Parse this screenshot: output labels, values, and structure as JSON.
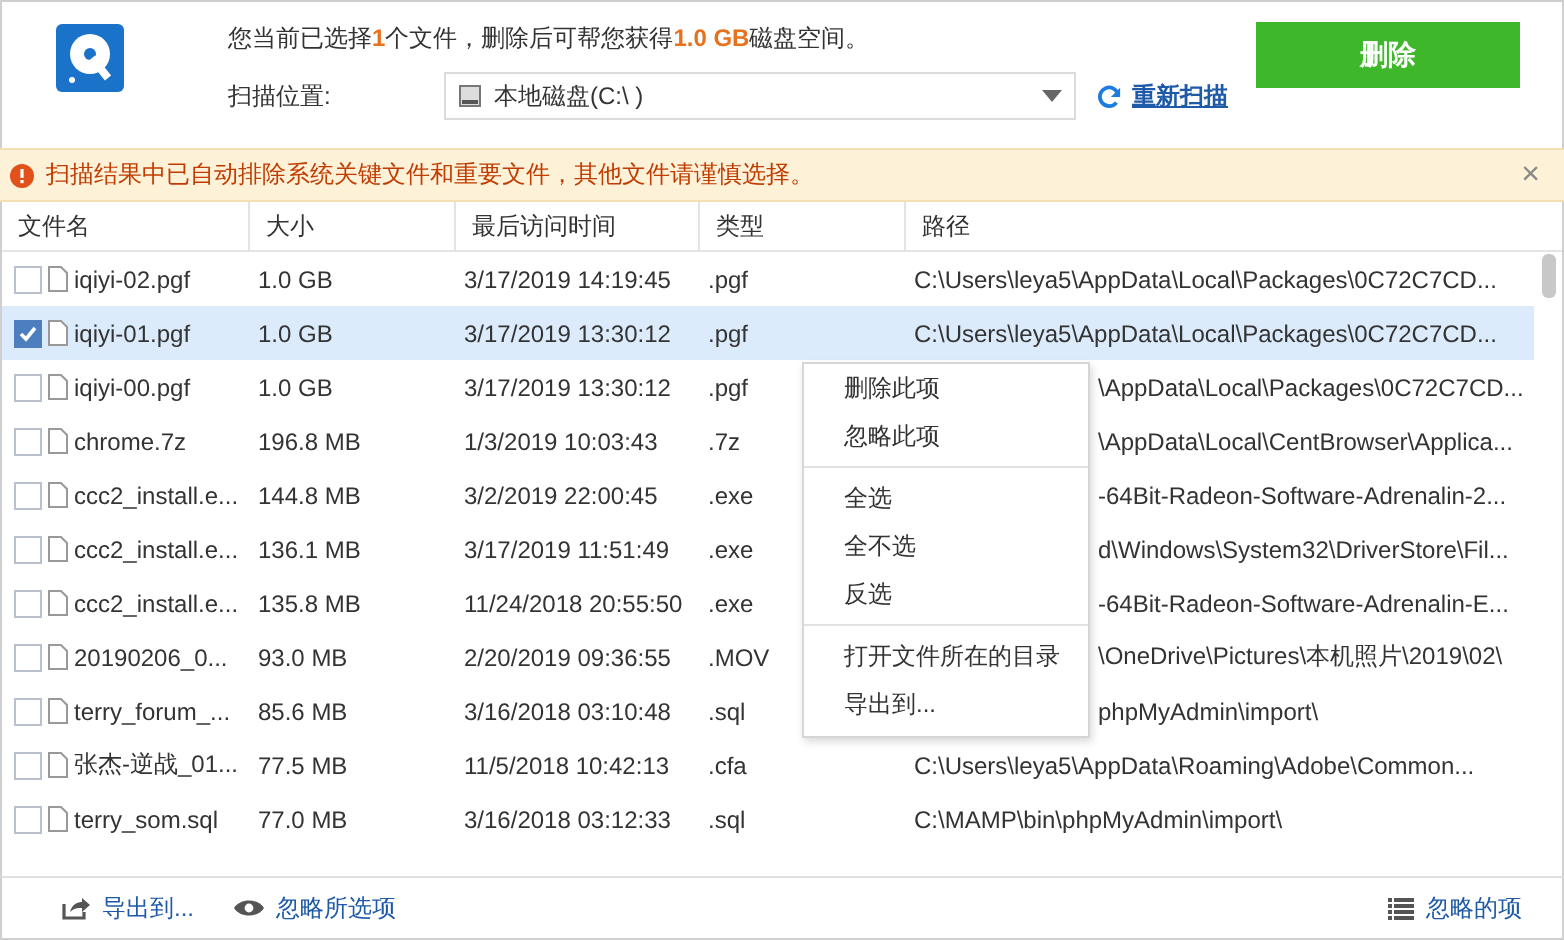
{
  "header": {
    "summary": "您当前已选择**1**个文件，删除后可帮您获得**1.0 GB**磁盘空间。",
    "scan_label": "扫描位置:",
    "location": "本地磁盘(C:\\ )",
    "rescan": "重新扫描",
    "delete_button": "删除"
  },
  "notice": {
    "text": "扫描结果中已自动排除系统关键文件和重要文件，其他文件请谨慎选择。",
    "close": "×"
  },
  "columns": [
    "文件名",
    "大小",
    "最后访问时间",
    "类型",
    "路径"
  ],
  "rows": [
    {
      "checked": false,
      "selected": false,
      "name": "iqiyi-02.pgf",
      "size": "1.0 GB",
      "time": "3/17/2019 14:19:45",
      "type": ".pgf",
      "path": "C:\\Users\\leya5\\AppData\\Local\\Packages\\0C72C7CD..."
    },
    {
      "checked": true,
      "selected": true,
      "name": "iqiyi-01.pgf",
      "size": "1.0 GB",
      "time": "3/17/2019 13:30:12",
      "type": ".pgf",
      "path": "C:\\Users\\leya5\\AppData\\Local\\Packages\\0C72C7CD..."
    },
    {
      "checked": false,
      "selected": false,
      "name": "iqiyi-00.pgf",
      "size": "1.0 GB",
      "time": "3/17/2019 13:30:12",
      "type": ".pgf",
      "path": "\\AppData\\Local\\Packages\\0C72C7CD..."
    },
    {
      "checked": false,
      "selected": false,
      "name": "chrome.7z",
      "size": "196.8 MB",
      "time": "1/3/2019 10:03:43",
      "type": ".7z",
      "path": "\\AppData\\Local\\CentBrowser\\Applica..."
    },
    {
      "checked": false,
      "selected": false,
      "name": "ccc2_install.e...",
      "size": "144.8 MB",
      "time": "3/2/2019 22:00:45",
      "type": ".exe",
      "path": "-64Bit-Radeon-Software-Adrenalin-2..."
    },
    {
      "checked": false,
      "selected": false,
      "name": "ccc2_install.e...",
      "size": "136.1 MB",
      "time": "3/17/2019 11:51:49",
      "type": ".exe",
      "path": "d\\Windows\\System32\\DriverStore\\Fil..."
    },
    {
      "checked": false,
      "selected": false,
      "name": "ccc2_install.e...",
      "size": "135.8 MB",
      "time": "11/24/2018 20:55:50",
      "type": ".exe",
      "path": "-64Bit-Radeon-Software-Adrenalin-E..."
    },
    {
      "checked": false,
      "selected": false,
      "name": "20190206_0...",
      "size": "93.0 MB",
      "time": "2/20/2019 09:36:55",
      "type": ".MOV",
      "path": "\\OneDrive\\Pictures\\本机照片\\2019\\02\\"
    },
    {
      "checked": false,
      "selected": false,
      "name": "terry_forum_...",
      "size": "85.6 MB",
      "time": "3/16/2018 03:10:48",
      "type": ".sql",
      "path": "phpMyAdmin\\import\\"
    },
    {
      "checked": false,
      "selected": false,
      "name": "张杰-逆战_01...",
      "size": "77.5 MB",
      "time": "11/5/2018 10:42:13",
      "type": ".cfa",
      "path": "C:\\Users\\leya5\\AppData\\Roaming\\Adobe\\Common..."
    },
    {
      "checked": false,
      "selected": false,
      "name": "terry_som.sql",
      "size": "77.0 MB",
      "time": "3/16/2018 03:12:33",
      "type": ".sql",
      "path": "C:\\MAMP\\bin\\phpMyAdmin\\import\\"
    }
  ],
  "context_menu": {
    "groups": [
      [
        "删除此项",
        "忽略此项"
      ],
      [
        "全选",
        "全不选",
        "反选"
      ],
      [
        "打开文件所在的目录",
        "导出到..."
      ]
    ]
  },
  "footer": {
    "export": "导出到...",
    "ignore_selected": "忽略所选项",
    "ignored": "忽略的项"
  }
}
